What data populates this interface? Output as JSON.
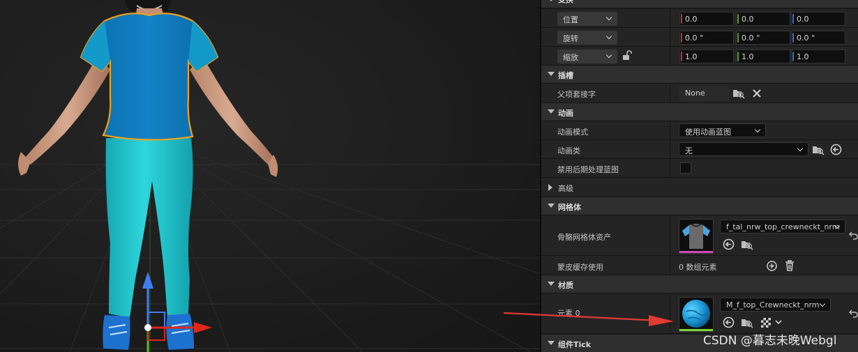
{
  "details": {
    "transform_header": "变换",
    "transform": {
      "location": {
        "label": "位置",
        "x": "0.0",
        "y": "0.0",
        "z": "0.0"
      },
      "rotation": {
        "label": "旋转",
        "x": "0.0 °",
        "y": "0.0 °",
        "z": "0.0 °"
      },
      "scale": {
        "label": "缩放",
        "x": "1.0",
        "y": "1.0",
        "z": "1.0"
      }
    },
    "sockets": {
      "header": "插槽",
      "parent_socket_label": "父项套接字",
      "parent_socket_value": "None"
    },
    "animation": {
      "header": "动画",
      "mode_label": "动画模式",
      "mode_value": "使用动画蓝图",
      "class_label": "动画类",
      "class_value": "无",
      "disable_post_label": "禁用后期处理蓝图"
    },
    "advanced": {
      "header": "高级"
    },
    "mesh": {
      "header": "网格体",
      "skeletal_mesh_label": "骨骼网格体资产",
      "skeletal_mesh_value": "f_tal_nrw_top_crewneckt_nrm",
      "skin_cache_label": "蒙皮缓存使用",
      "skin_cache_value": "0 数组元素"
    },
    "materials": {
      "header": "材质",
      "element0_label": "元素 0",
      "element0_value": "M_f_top_Crewneckt_nrm"
    },
    "component_tick": {
      "header": "组件Tick"
    }
  },
  "watermark": "CSDN @暮志未晚Webgl",
  "colors": {
    "shirt": "#0f7fc4",
    "pants": "#1fc8d0",
    "selection_outline": "#f0a21c",
    "annotation_arrow": "#e23b33"
  }
}
